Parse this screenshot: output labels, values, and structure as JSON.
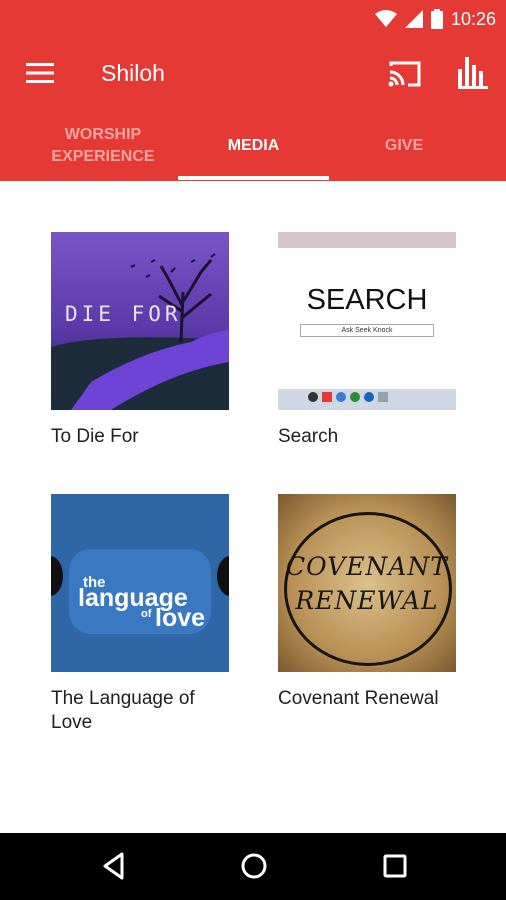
{
  "status_bar": {
    "time": "10:26",
    "icons": [
      "wifi-icon",
      "signal-icon",
      "battery-icon"
    ]
  },
  "app_bar": {
    "title": "Shiloh",
    "icons": [
      "menu-icon",
      "cast-icon",
      "stats-icon"
    ]
  },
  "tabs": [
    {
      "label": "WORSHIP\nEXPERIENCE",
      "active": false
    },
    {
      "label": "MEDIA",
      "active": true
    },
    {
      "label": "GIVE",
      "active": false
    }
  ],
  "media": [
    {
      "title": "To Die For",
      "thumb_text": "DIE FOR"
    },
    {
      "title": "Search",
      "thumb_text": "SEARCH",
      "thumb_subtext": "Ask Seek Knock"
    },
    {
      "title": "The Language of Love",
      "thumb_text": [
        "the",
        "language",
        "of",
        "love"
      ]
    },
    {
      "title": "Covenant Renewal",
      "thumb_text": [
        "COVENANT",
        "RENEWAL"
      ]
    }
  ],
  "colors": {
    "primary": "#e53935",
    "tab_inactive": "#f3a5a2",
    "text": "#212121"
  },
  "nav_bar": {
    "icons": [
      "back-icon",
      "home-icon",
      "recents-icon"
    ]
  }
}
